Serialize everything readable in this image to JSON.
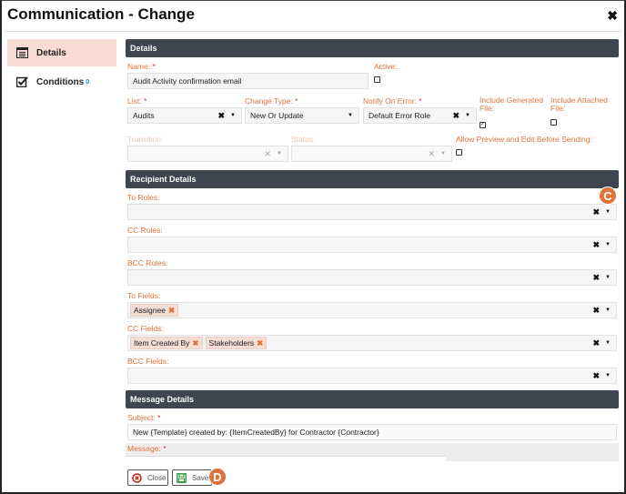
{
  "window": {
    "title": "Communication - Change",
    "close_icon": "close-icon"
  },
  "sidebar": {
    "items": [
      {
        "label": "Details",
        "icon": "list-box-icon",
        "active": true
      },
      {
        "label": "Conditions",
        "icon": "checkbox-checked-icon",
        "count": "0"
      }
    ]
  },
  "details": {
    "header": "Details",
    "name": {
      "label": "Name:",
      "value": "Audit Activity confirmation email",
      "required": "*"
    },
    "active": {
      "label": "Active:",
      "checked": false
    },
    "list": {
      "label": "List:",
      "value": "Audits",
      "required": "*"
    },
    "change_type": {
      "label": "Change Type:",
      "value": "New Or Update",
      "required": "*"
    },
    "notify_on_error": {
      "label": "Notify On Error:",
      "value": "Default Error Role",
      "required": "*"
    },
    "include_generated": {
      "label": "Include Generated File:",
      "checked": true
    },
    "include_attached": {
      "label": "Include Attached File:",
      "checked": false
    },
    "transition": {
      "label": "Transition:",
      "value": ""
    },
    "status": {
      "label": "Status:",
      "value": ""
    },
    "allow_preview": {
      "label": "Allow Preview and Edit Before Sending:",
      "checked": false
    }
  },
  "recipients": {
    "header": "Recipient Details",
    "to_roles": {
      "label": "To Roles:",
      "tags": []
    },
    "cc_roles": {
      "label": "CC Roles:",
      "tags": []
    },
    "bcc_roles": {
      "label": "BCC Roles:",
      "tags": []
    },
    "to_fields": {
      "label": "To Fields:",
      "tags": [
        "Assignee"
      ]
    },
    "cc_fields": {
      "label": "CC Fields:",
      "tags": [
        "Item Created By",
        "Stakeholders"
      ]
    },
    "bcc_fields": {
      "label": "BCC Fields:",
      "tags": []
    }
  },
  "message": {
    "header": "Message Details",
    "subject": {
      "label": "Subject:",
      "value": "New {Template} created by: {ItemCreatedBy} for Contractor {Contractor}",
      "required": "*"
    },
    "message": {
      "label": "Message:",
      "required": "*"
    }
  },
  "buttons": {
    "close": "Close",
    "save": "Save"
  },
  "annotations": {
    "c": "C",
    "d": "D"
  },
  "colors": {
    "accent": "#e0733a",
    "section_header": "#3f4550",
    "active_nav": "#f8dcd3"
  }
}
